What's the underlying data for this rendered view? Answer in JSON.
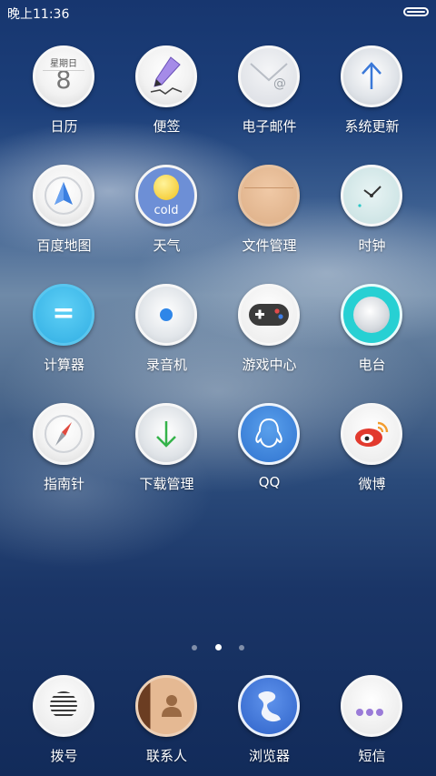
{
  "status_bar": {
    "time": "晚上11:36"
  },
  "apps": [
    {
      "label": "日历",
      "calendar_weekday": "星期日",
      "calendar_day": "8"
    },
    {
      "label": "便签"
    },
    {
      "label": "电子邮件"
    },
    {
      "label": "系统更新"
    },
    {
      "label": "百度地图"
    },
    {
      "label": "天气",
      "weather_text": "cold"
    },
    {
      "label": "文件管理"
    },
    {
      "label": "时钟"
    },
    {
      "label": "计算器",
      "calculator_symbol": "="
    },
    {
      "label": "录音机"
    },
    {
      "label": "游戏中心"
    },
    {
      "label": "电台"
    },
    {
      "label": "指南针"
    },
    {
      "label": "下载管理"
    },
    {
      "label": "QQ"
    },
    {
      "label": "微博"
    }
  ],
  "page_indicator": {
    "pages": 3,
    "current": 2
  },
  "dock": [
    {
      "label": "拨号"
    },
    {
      "label": "联系人"
    },
    {
      "label": "浏览器"
    },
    {
      "label": "短信"
    }
  ],
  "colors": {
    "calculator": "#3fb7ea",
    "radio_teal": "#27d0d3",
    "weather_blue": "#6d8fd6",
    "file_peach": "#e3b791",
    "clock_mint": "#cfe6e6",
    "browser_blue": "#3f73d6",
    "qq_blue": "#3e86da",
    "weibo_red": "#e23a2e",
    "sms_purple": "#9a7bd8"
  }
}
